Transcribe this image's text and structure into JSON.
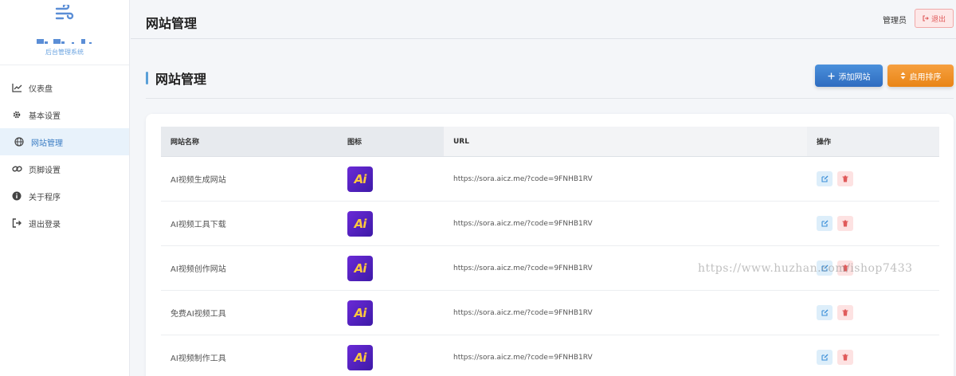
{
  "brand": {
    "subtitle": "后台管理系统"
  },
  "sidebar": {
    "items": [
      {
        "label": "仪表盘",
        "icon": "chart-line-icon"
      },
      {
        "label": "基本设置",
        "icon": "gear-icon"
      },
      {
        "label": "网站管理",
        "icon": "globe-icon",
        "active": true
      },
      {
        "label": "页脚设置",
        "icon": "link-icon"
      },
      {
        "label": "关于程序",
        "icon": "info-icon"
      },
      {
        "label": "退出登录",
        "icon": "sign-out-icon"
      }
    ]
  },
  "header": {
    "title": "网站管理",
    "user": "管理员",
    "logout_label": "退出"
  },
  "section": {
    "title": "网站管理",
    "add_label": "添加网站",
    "sort_label": "启用排序"
  },
  "table": {
    "columns": [
      "网站名称",
      "图标",
      "URL",
      "操作"
    ],
    "rows": [
      {
        "name": "AI视频生成网站",
        "url": "https://sora.aicz.me/?code=9FNHB1RV"
      },
      {
        "name": "AI视频工具下载",
        "url": "https://sora.aicz.me/?code=9FNHB1RV"
      },
      {
        "name": "AI视频创作网站",
        "url": "https://sora.aicz.me/?code=9FNHB1RV"
      },
      {
        "name": "免费AI视频工具",
        "url": "https://sora.aicz.me/?code=9FNHB1RV"
      },
      {
        "name": "AI视频制作工具",
        "url": "https://sora.aicz.me/?code=9FNHB1RV"
      }
    ],
    "icon_text": "Ai"
  },
  "watermark": "https://www.huzhan.com/ishop7433",
  "colors": {
    "accent": "#3b7dc4",
    "add_button": "#2f6cc0",
    "sort_button": "#e98516",
    "danger": "#e05a5a"
  }
}
